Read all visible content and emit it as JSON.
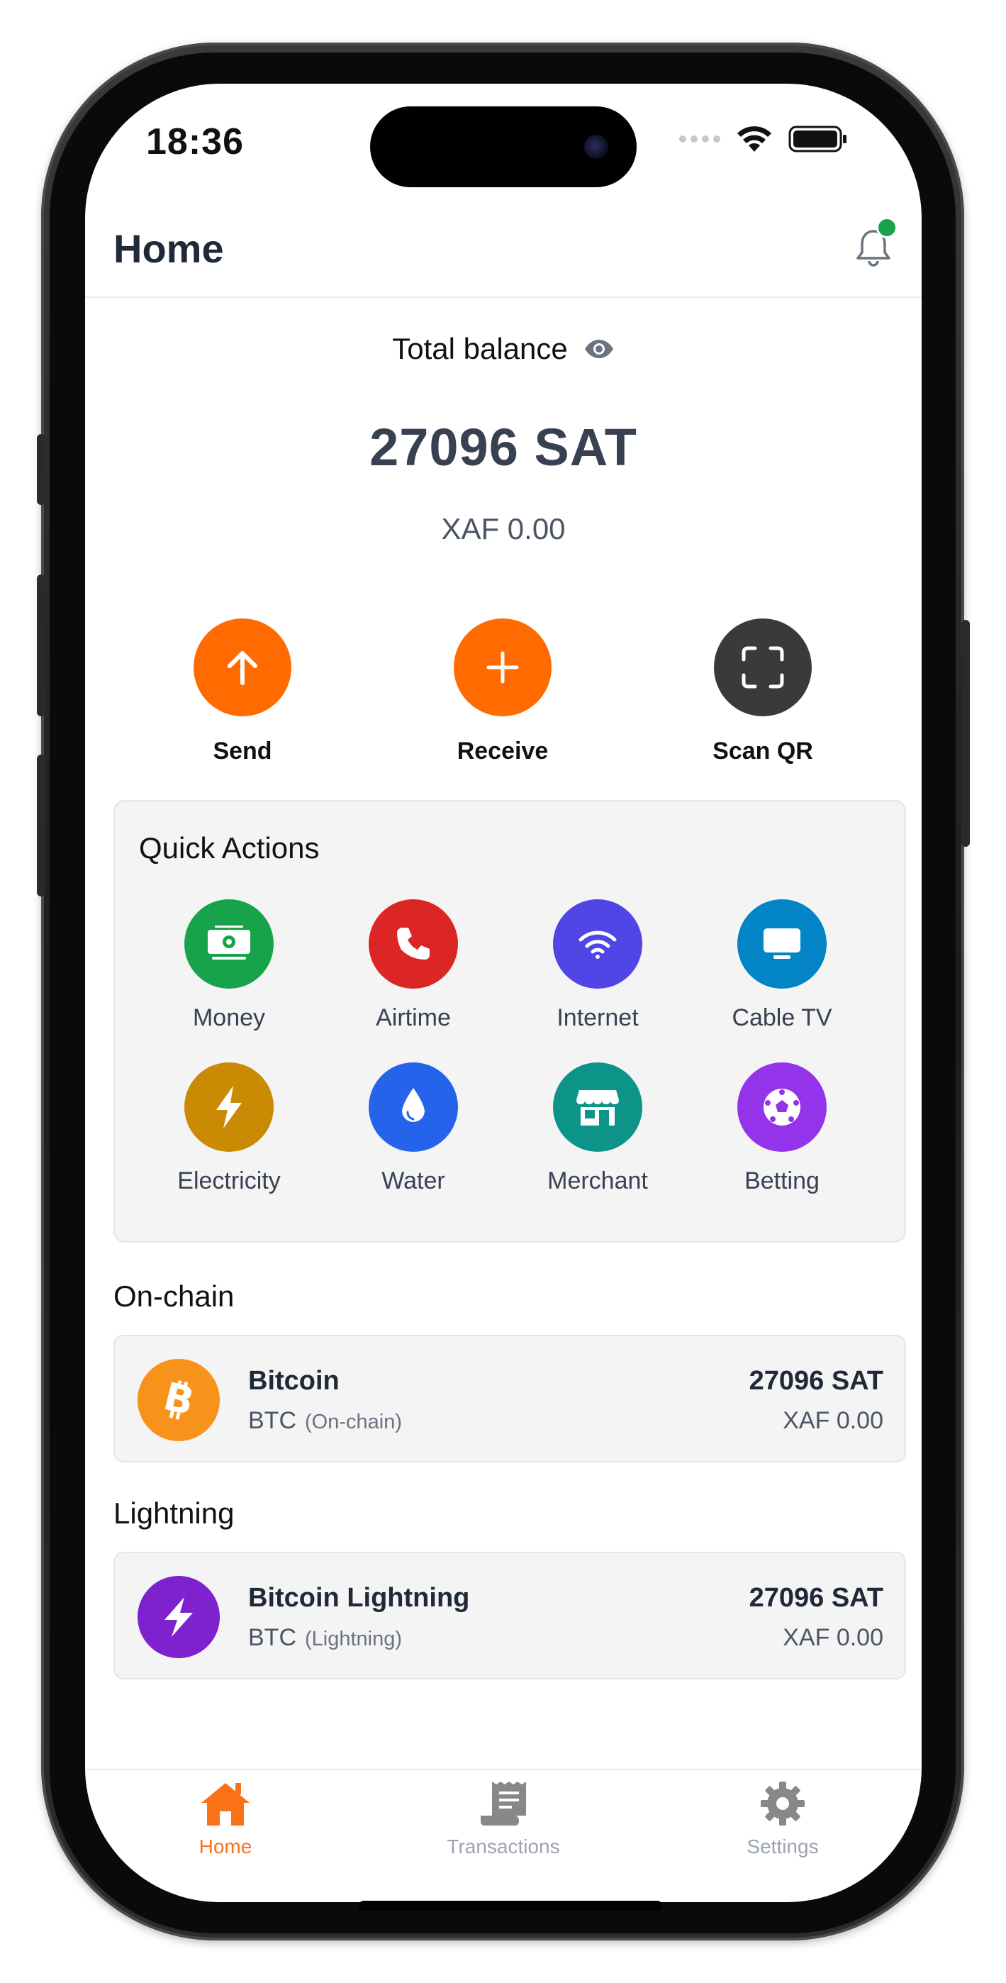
{
  "status_bar": {
    "time": "18:36"
  },
  "header": {
    "title": "Home"
  },
  "balance": {
    "label": "Total balance",
    "amount": "27096 SAT",
    "fiat": "XAF 0.00"
  },
  "actions": {
    "send": "Send",
    "receive": "Receive",
    "scan": "Scan QR"
  },
  "quick_actions": {
    "title": "Quick Actions",
    "items": [
      {
        "label": "Money",
        "icon": "money-icon",
        "color": "#16a34a"
      },
      {
        "label": "Airtime",
        "icon": "phone-icon",
        "color": "#dc2626"
      },
      {
        "label": "Internet",
        "icon": "wifi-icon",
        "color": "#4f46e5"
      },
      {
        "label": "Cable TV",
        "icon": "tv-icon",
        "color": "#0284c7"
      },
      {
        "label": "Electricity",
        "icon": "bolt-icon",
        "color": "#ca8a04"
      },
      {
        "label": "Water",
        "icon": "droplet-icon",
        "color": "#2563eb"
      },
      {
        "label": "Merchant",
        "icon": "store-icon",
        "color": "#0d9488"
      },
      {
        "label": "Betting",
        "icon": "soccer-ball-icon",
        "color": "#9333ea"
      }
    ]
  },
  "onchain": {
    "title": "On-chain",
    "wallet": {
      "name": "Bitcoin",
      "ticker": "BTC",
      "network": "(On-chain)",
      "amount": "27096 SAT",
      "fiat": "XAF 0.00",
      "icon_color": "#f7931a"
    }
  },
  "lightning": {
    "title": "Lightning",
    "wallet": {
      "name": "Bitcoin Lightning",
      "ticker": "BTC",
      "network": "(Lightning)",
      "amount": "27096 SAT",
      "fiat": "XAF 0.00",
      "icon_color": "#7e22ce"
    }
  },
  "tabbar": {
    "home": "Home",
    "transactions": "Transactions",
    "settings": "Settings",
    "active_color": "#f97316"
  },
  "colors": {
    "accent": "#ff6b00",
    "scan": "#3a3a3a",
    "notification_dot": "#16a34a"
  }
}
